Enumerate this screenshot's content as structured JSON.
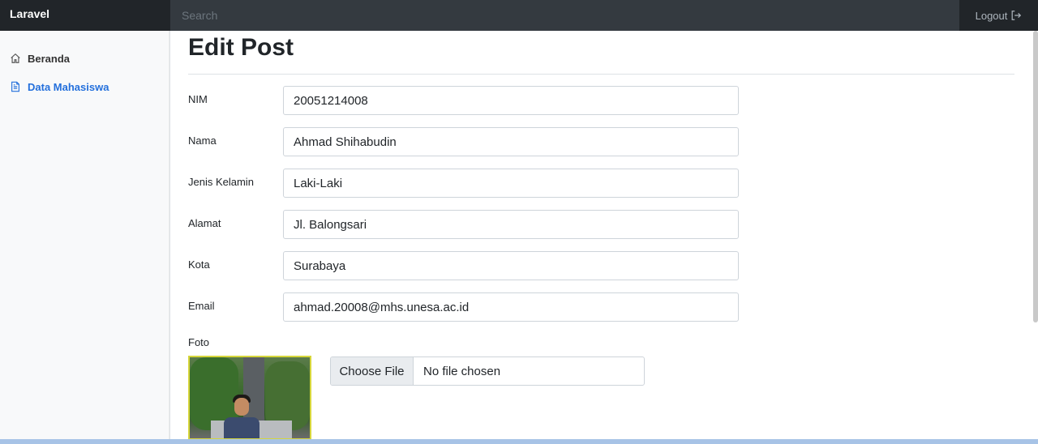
{
  "navbar": {
    "brand": "Laravel",
    "search_placeholder": "Search",
    "logout_label": "Logout"
  },
  "sidebar": {
    "items": [
      {
        "label": "Beranda",
        "icon": "home-icon",
        "active": false
      },
      {
        "label": "Data Mahasiswa",
        "icon": "file-text-icon",
        "active": true
      }
    ]
  },
  "main": {
    "title": "Edit Post",
    "fields": [
      {
        "label": "NIM",
        "value": "20051214008"
      },
      {
        "label": "Nama",
        "value": "Ahmad Shihabudin"
      },
      {
        "label": "Jenis Kelamin",
        "value": "Laki-Laki"
      },
      {
        "label": "Alamat",
        "value": "Jl. Balongsari"
      },
      {
        "label": "Kota",
        "value": "Surabaya"
      },
      {
        "label": "Email",
        "value": "ahmad.20008@mhs.unesa.ac.id"
      }
    ],
    "foto_label": "Foto",
    "file_button_label": "Choose File",
    "file_status": "No file chosen"
  },
  "colors": {
    "navbar_bg": "#343a40",
    "brand_bg": "#212529",
    "sidebar_bg": "#f8f9fa",
    "active_link": "#2470dc"
  }
}
